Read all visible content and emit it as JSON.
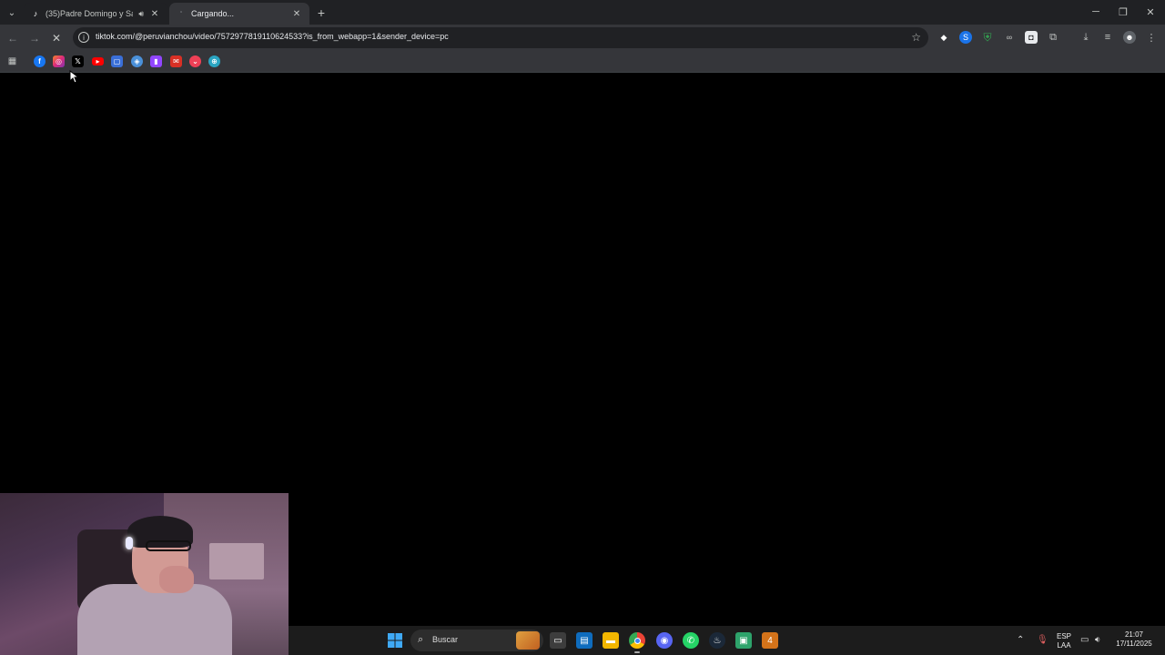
{
  "browser": {
    "tabs": [
      {
        "title": "(35)Padre Domingo y Sach...",
        "favicon": "tiktok-icon",
        "audio": true,
        "active": false
      },
      {
        "title": "Cargando...",
        "favicon": "loading-icon",
        "audio": false,
        "active": true
      }
    ],
    "url": "tiktok.com/@peruvianchou/video/7572977819110624533?is_from_webapp=1&sender_device=pc",
    "bookmarks": [
      "facebook-icon",
      "instagram-icon",
      "x-icon",
      "youtube-icon",
      "roblox-icon",
      "app-icon",
      "twitch-icon",
      "mail-icon",
      "pocket-icon",
      "globe-icon"
    ],
    "extensions": [
      "diamond-icon",
      "shield-blue-icon",
      "shield-green-icon",
      "glasses-icon",
      "camera-icon",
      "puzzle-icon"
    ]
  },
  "taskbar": {
    "search_placeholder": "Buscar",
    "language": "ESP",
    "layout": "LAA",
    "time": "21:07",
    "date": "17/11/2025",
    "discord_badge": "1"
  },
  "colors": {
    "tabbar": "#202124",
    "toolbar": "#35363a",
    "content": "#000000",
    "taskbar": "#1c1c1c"
  }
}
